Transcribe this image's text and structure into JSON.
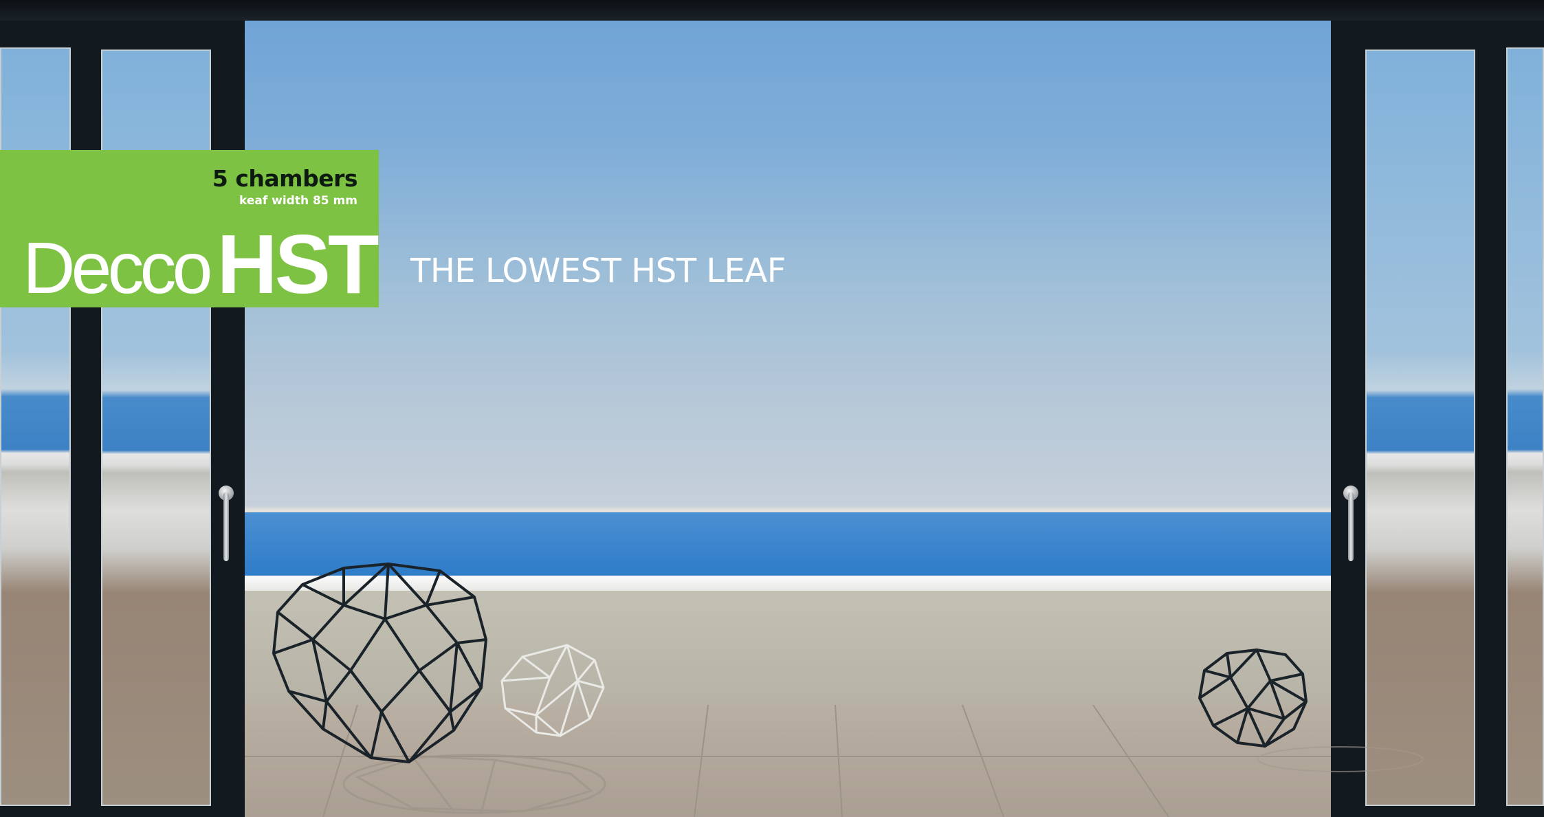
{
  "brand": {
    "chambers": "5 chambers",
    "leaf_width": "keaf width 85 mm",
    "name_light": "Decco",
    "name_bold": "HST"
  },
  "tagline": "THE LOWEST HST LEAF",
  "colors": {
    "brand_green": "#7dc242",
    "frame": "#121a1f",
    "sky_top": "#6ea3d6",
    "sea": "#3e87cf"
  },
  "icons": {
    "left_handle": "door-handle-icon",
    "right_handle": "door-handle-icon"
  }
}
